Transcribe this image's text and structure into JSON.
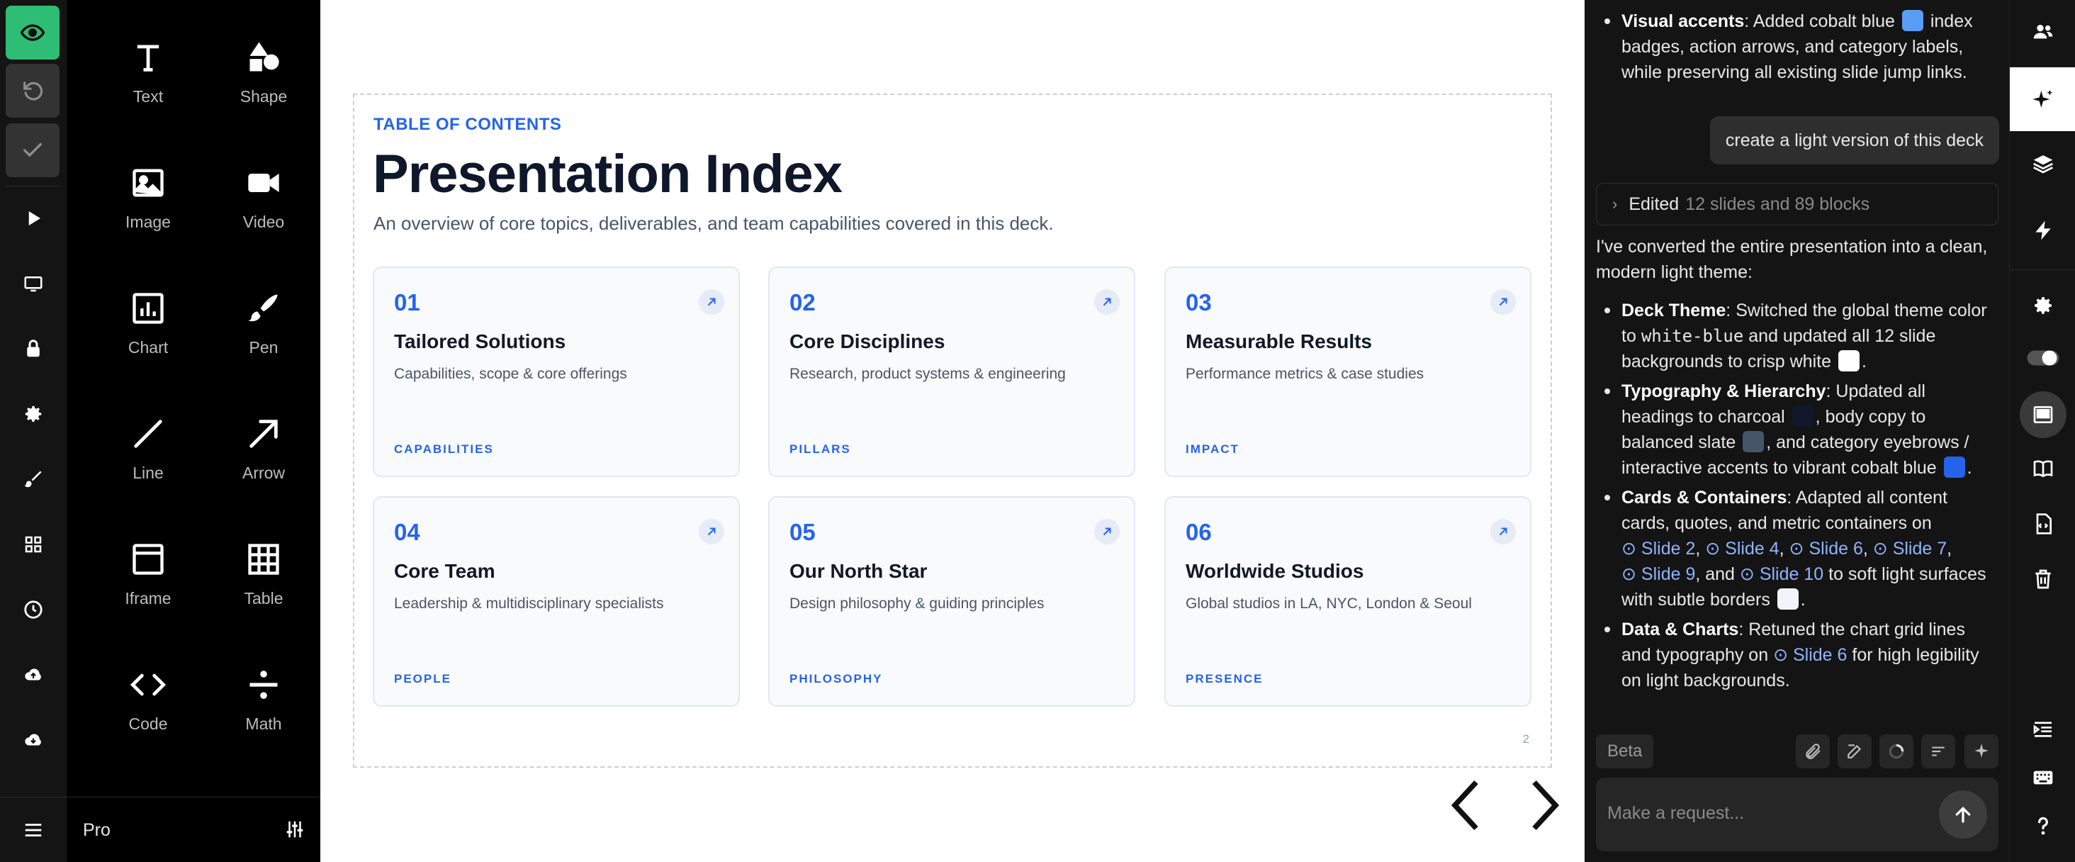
{
  "colors": {
    "accent_blue": "#2563eb",
    "green": "#2ebd74",
    "charcoal": "#0f172a",
    "slate": "#475569",
    "white": "#ffffff"
  },
  "left_rail": {
    "icons": [
      "eye-icon",
      "undo-icon",
      "check-icon",
      "play-icon",
      "monitor-icon",
      "lock-icon",
      "gear-icon",
      "brush-icon",
      "grid-icon",
      "clock-icon",
      "cloud-upload-icon",
      "cloud-download-icon",
      "menu-icon"
    ]
  },
  "tools": {
    "items": [
      {
        "label": "Text",
        "icon": "text-icon"
      },
      {
        "label": "Shape",
        "icon": "shape-icon"
      },
      {
        "label": "Image",
        "icon": "image-icon"
      },
      {
        "label": "Video",
        "icon": "video-icon"
      },
      {
        "label": "Chart",
        "icon": "chart-icon"
      },
      {
        "label": "Pen",
        "icon": "pen-icon"
      },
      {
        "label": "Line",
        "icon": "line-icon"
      },
      {
        "label": "Arrow",
        "icon": "arrow-icon"
      },
      {
        "label": "Iframe",
        "icon": "iframe-icon"
      },
      {
        "label": "Table",
        "icon": "table-icon"
      },
      {
        "label": "Code",
        "icon": "code-icon"
      },
      {
        "label": "Math",
        "icon": "math-icon"
      }
    ],
    "plan_label": "Pro"
  },
  "slide": {
    "eyebrow": "TABLE OF CONTENTS",
    "title": "Presentation Index",
    "subtitle": "An overview of core topics, deliverables, and team capabilities covered in this deck.",
    "page_number": "2",
    "cards": [
      {
        "num": "01",
        "title": "Tailored Solutions",
        "desc": "Capabilities, scope & core offerings",
        "tag": "CAPABILITIES"
      },
      {
        "num": "02",
        "title": "Core Disciplines",
        "desc": "Research, product systems & engineering",
        "tag": "PILLARS"
      },
      {
        "num": "03",
        "title": "Measurable Results",
        "desc": "Performance metrics & case studies",
        "tag": "IMPACT"
      },
      {
        "num": "04",
        "title": "Core Team",
        "desc": "Leadership & multidisciplinary specialists",
        "tag": "PEOPLE"
      },
      {
        "num": "05",
        "title": "Our North Star",
        "desc": "Design philosophy & guiding principles",
        "tag": "PHILOSOPHY"
      },
      {
        "num": "06",
        "title": "Worldwide Studios",
        "desc": "Global studios in LA, NYC, London & Seoul",
        "tag": "PRESENCE"
      }
    ]
  },
  "chat": {
    "prev_bullet": {
      "label": "Visual accents",
      "text_a": ": Added cobalt blue",
      "text_b": "index badges, action arrows, and category labels, while preserving all existing slide jump links."
    },
    "user_message": "create a light version of this deck",
    "edited": {
      "label": "Edited",
      "detail": "12 slides and 89 blocks"
    },
    "intro": "I've converted the entire presentation into a clean, modern light theme:",
    "deck_theme": {
      "label": "Deck Theme",
      "text_a": ": Switched the global theme color to",
      "code": "white-blue",
      "text_b": "and updated all 12 slide backgrounds to crisp white",
      "end": "."
    },
    "typography": {
      "label": "Typography & Hierarchy",
      "text_a": ": Updated all headings to charcoal",
      "text_b": ", body copy to balanced slate",
      "text_c": ", and category eyebrows / interactive accents to vibrant cobalt blue",
      "end": "."
    },
    "cards_containers": {
      "label": "Cards & Containers",
      "text_a": ": Adapted all content cards, quotes, and metric containers on",
      "links": [
        "Slide 2",
        "Slide 4",
        "Slide 6",
        "Slide 7",
        "Slide 9"
      ],
      "and": ", and",
      "last_link": "Slide 10",
      "text_b": "to soft light surfaces with subtle borders",
      "end": "."
    },
    "data_charts": {
      "label": "Data & Charts",
      "text_a": ": Retuned the chart grid lines and typography on",
      "link": "Slide 6",
      "text_b": "for high legibility on light backgrounds."
    },
    "beta_label": "Beta",
    "input_placeholder": "Make a request..."
  },
  "right_rail": {
    "icons": [
      "users-icon",
      "sparkle-icon",
      "layers-icon",
      "bolt-icon",
      "gear-icon",
      "toggle-icon",
      "frame-icon",
      "book-icon",
      "code-file-icon",
      "trash-icon",
      "indent-icon",
      "keyboard-icon",
      "help-icon"
    ]
  }
}
